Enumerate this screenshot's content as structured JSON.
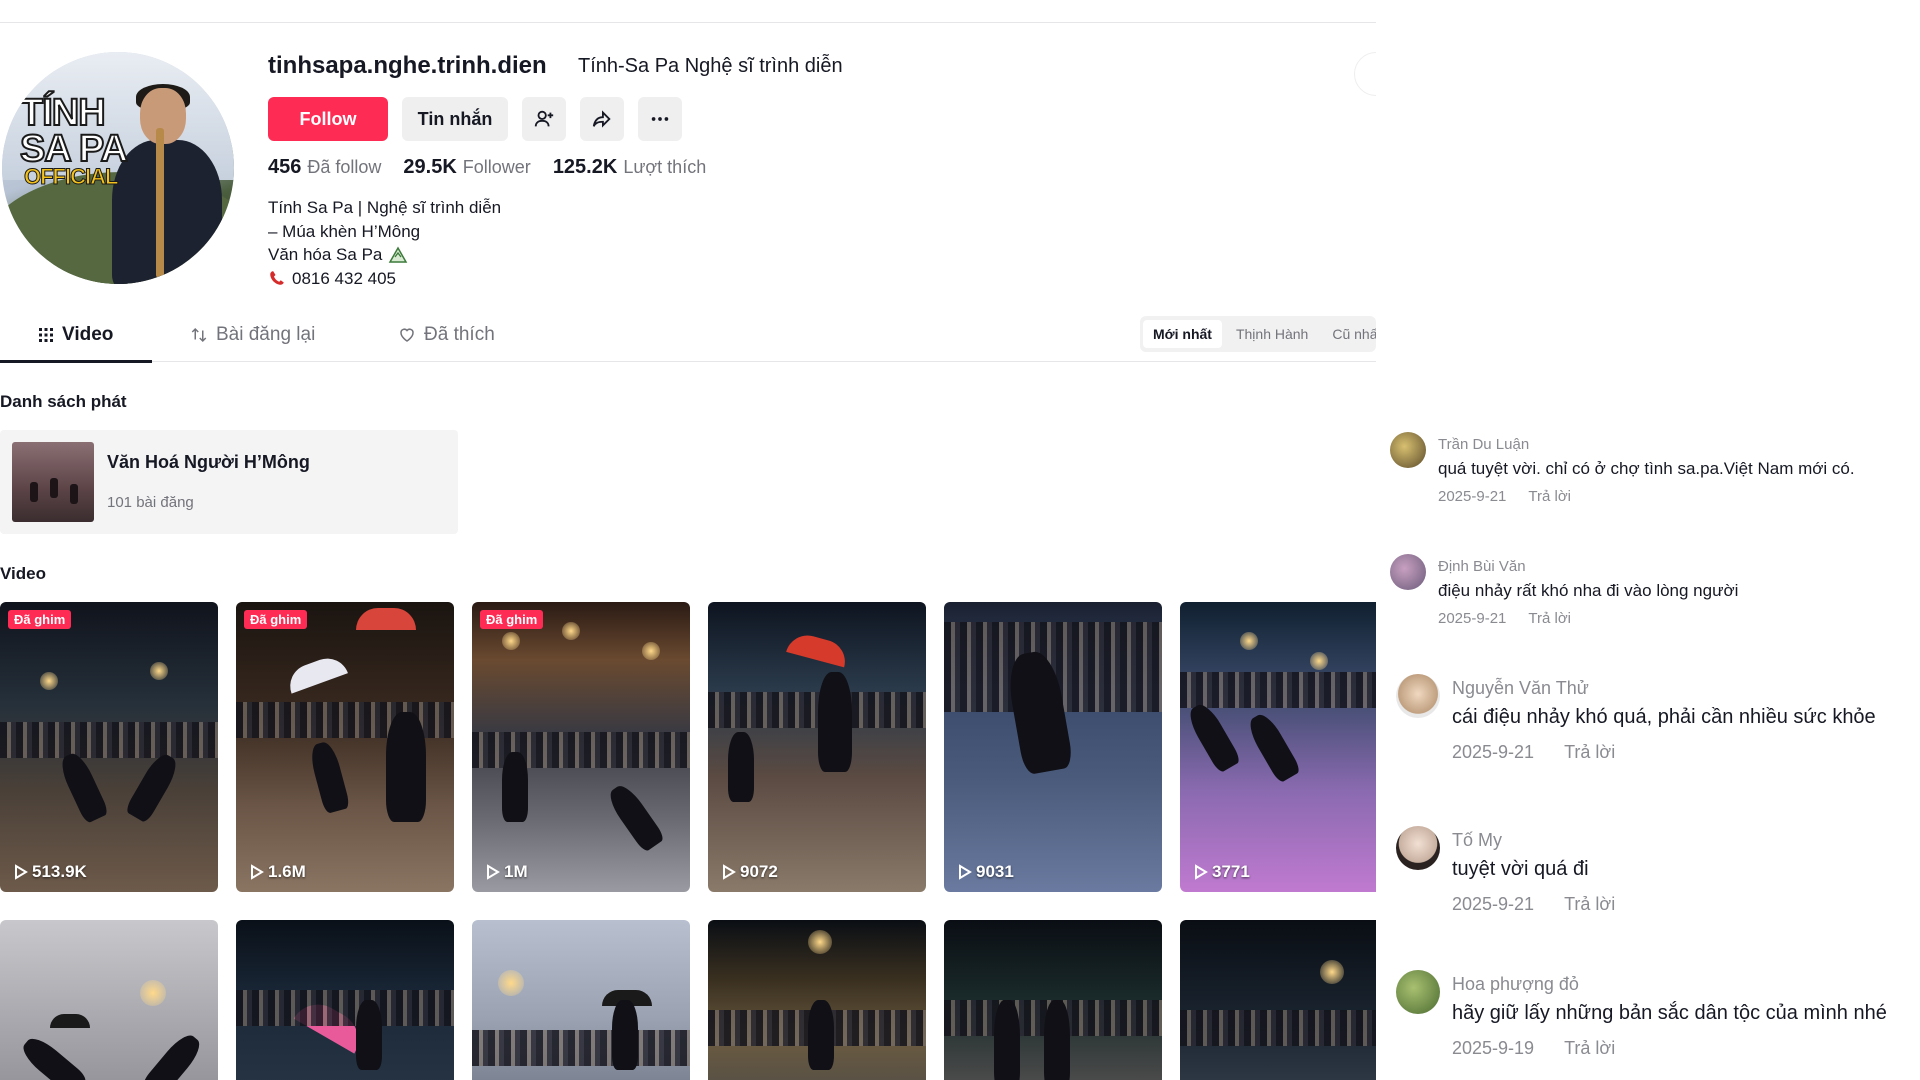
{
  "profile": {
    "username": "tinhsapa.nghe.trinh.dien",
    "nickname": "Tính-Sa Pa Nghệ sĩ trình diễn",
    "avatar_text": [
      "TÍNH",
      "SA PA",
      "OFFICIAL"
    ],
    "follow_label": "Follow",
    "message_label": "Tin nhắn",
    "stats": [
      {
        "value": "456",
        "label": "Đã follow"
      },
      {
        "value": "29.5K",
        "label": "Follower"
      },
      {
        "value": "125.2K",
        "label": "Lượt thích"
      }
    ],
    "bio": [
      "Tính Sa Pa | Nghệ sĩ trình diễn",
      "– Múa khèn H’Mông",
      "Văn hóa Sa Pa",
      "0816 432 405"
    ]
  },
  "tabs": [
    {
      "label": "Video"
    },
    {
      "label": "Bài đăng lại"
    },
    {
      "label": "Đã thích"
    }
  ],
  "sort": [
    "Mới nhất",
    "Thịnh Hành",
    "Cũ nhất"
  ],
  "playlist_section": "Danh sách phát",
  "playlist": {
    "title": "Văn Hoá Người H’Mông",
    "count": "101 bài đăng"
  },
  "video_section": "Video",
  "pinned_label": "Đã ghim",
  "videos": [
    {
      "views": "513.9K",
      "pinned": true
    },
    {
      "views": "1.6M",
      "pinned": true
    },
    {
      "views": "1M",
      "pinned": true
    },
    {
      "views": "9072",
      "pinned": false
    },
    {
      "views": "9031",
      "pinned": false
    },
    {
      "views": "3771",
      "pinned": false
    }
  ],
  "comments": [
    {
      "name": "Trần Du Luận",
      "text": "quá tuyệt vời. chỉ có ở chợ tình sa.pa.Việt Nam mới có.",
      "date": "2025-9-21",
      "reply": "Trả lời"
    },
    {
      "name": "Định Bùi Văn",
      "text": "điệu nhảy rất khó nha đi vào lòng người",
      "date": "2025-9-21",
      "reply": "Trả lời"
    },
    {
      "name": "Nguyễn Văn Thử",
      "text": "cái điệu nhảy khó quá, phải cần nhiều sức khỏe",
      "date": "2025-9-21",
      "reply": "Trả lời"
    },
    {
      "name": "Tố My",
      "text": "tuyệt vời quá đi",
      "date": "2025-9-21",
      "reply": "Trả lời"
    },
    {
      "name": "Hoa phượng đỏ",
      "text": "hãy giữ lấy những bản sắc dân tộc của mình nhé",
      "date": "2025-9-19",
      "reply": "Trả lời"
    }
  ],
  "colors": {
    "accent": "#fe2c55",
    "text": "#161823",
    "muted": "#73747b"
  }
}
